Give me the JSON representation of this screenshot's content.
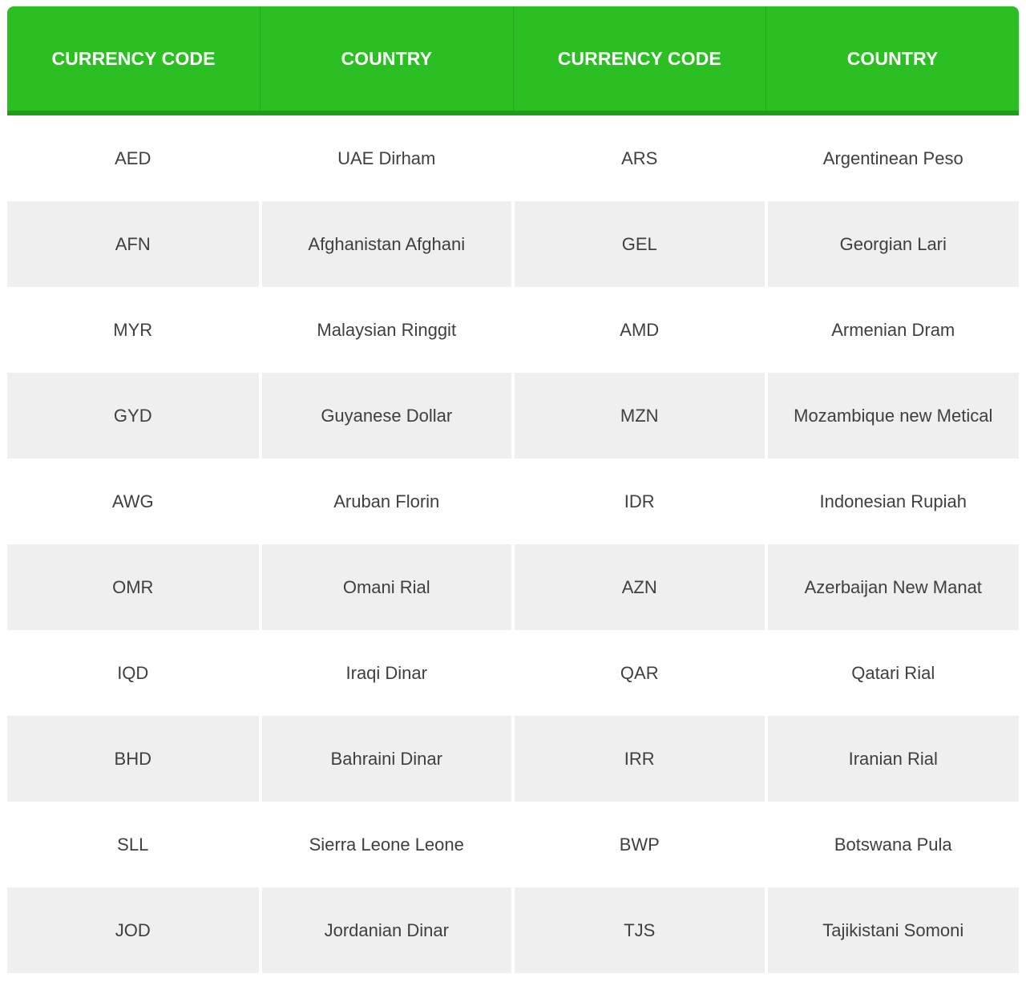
{
  "table": {
    "headers": [
      "CURRENCY CODE",
      "COUNTRY",
      "CURRENCY CODE",
      "COUNTRY"
    ],
    "rows": [
      [
        "AED",
        "UAE Dirham",
        "ARS",
        "Argentinean Peso"
      ],
      [
        "AFN",
        "Afghanistan Afghani",
        "GEL",
        "Georgian Lari"
      ],
      [
        "MYR",
        "Malaysian Ringgit",
        "AMD",
        "Armenian Dram"
      ],
      [
        "GYD",
        "Guyanese Dollar",
        "MZN",
        "Mozambique new Metical"
      ],
      [
        "AWG",
        "Aruban Florin",
        "IDR",
        "Indonesian Rupiah"
      ],
      [
        "OMR",
        "Omani Rial",
        "AZN",
        "Azerbaijan New Manat"
      ],
      [
        "IQD",
        "Iraqi Dinar",
        "QAR",
        "Qatari Rial"
      ],
      [
        "BHD",
        "Bahraini Dinar",
        "IRR",
        "Iranian Rial"
      ],
      [
        "SLL",
        "Sierra Leone Leone",
        "BWP",
        "Botswana Pula"
      ],
      [
        "JOD",
        "Jordanian Dinar",
        "TJS",
        "Tajikistani Somoni"
      ]
    ]
  },
  "colors": {
    "header_bg": "#2cbf23",
    "header_text": "#ffffff",
    "row_alt_bg": "#efefef",
    "cell_text": "#3f3f3f"
  }
}
